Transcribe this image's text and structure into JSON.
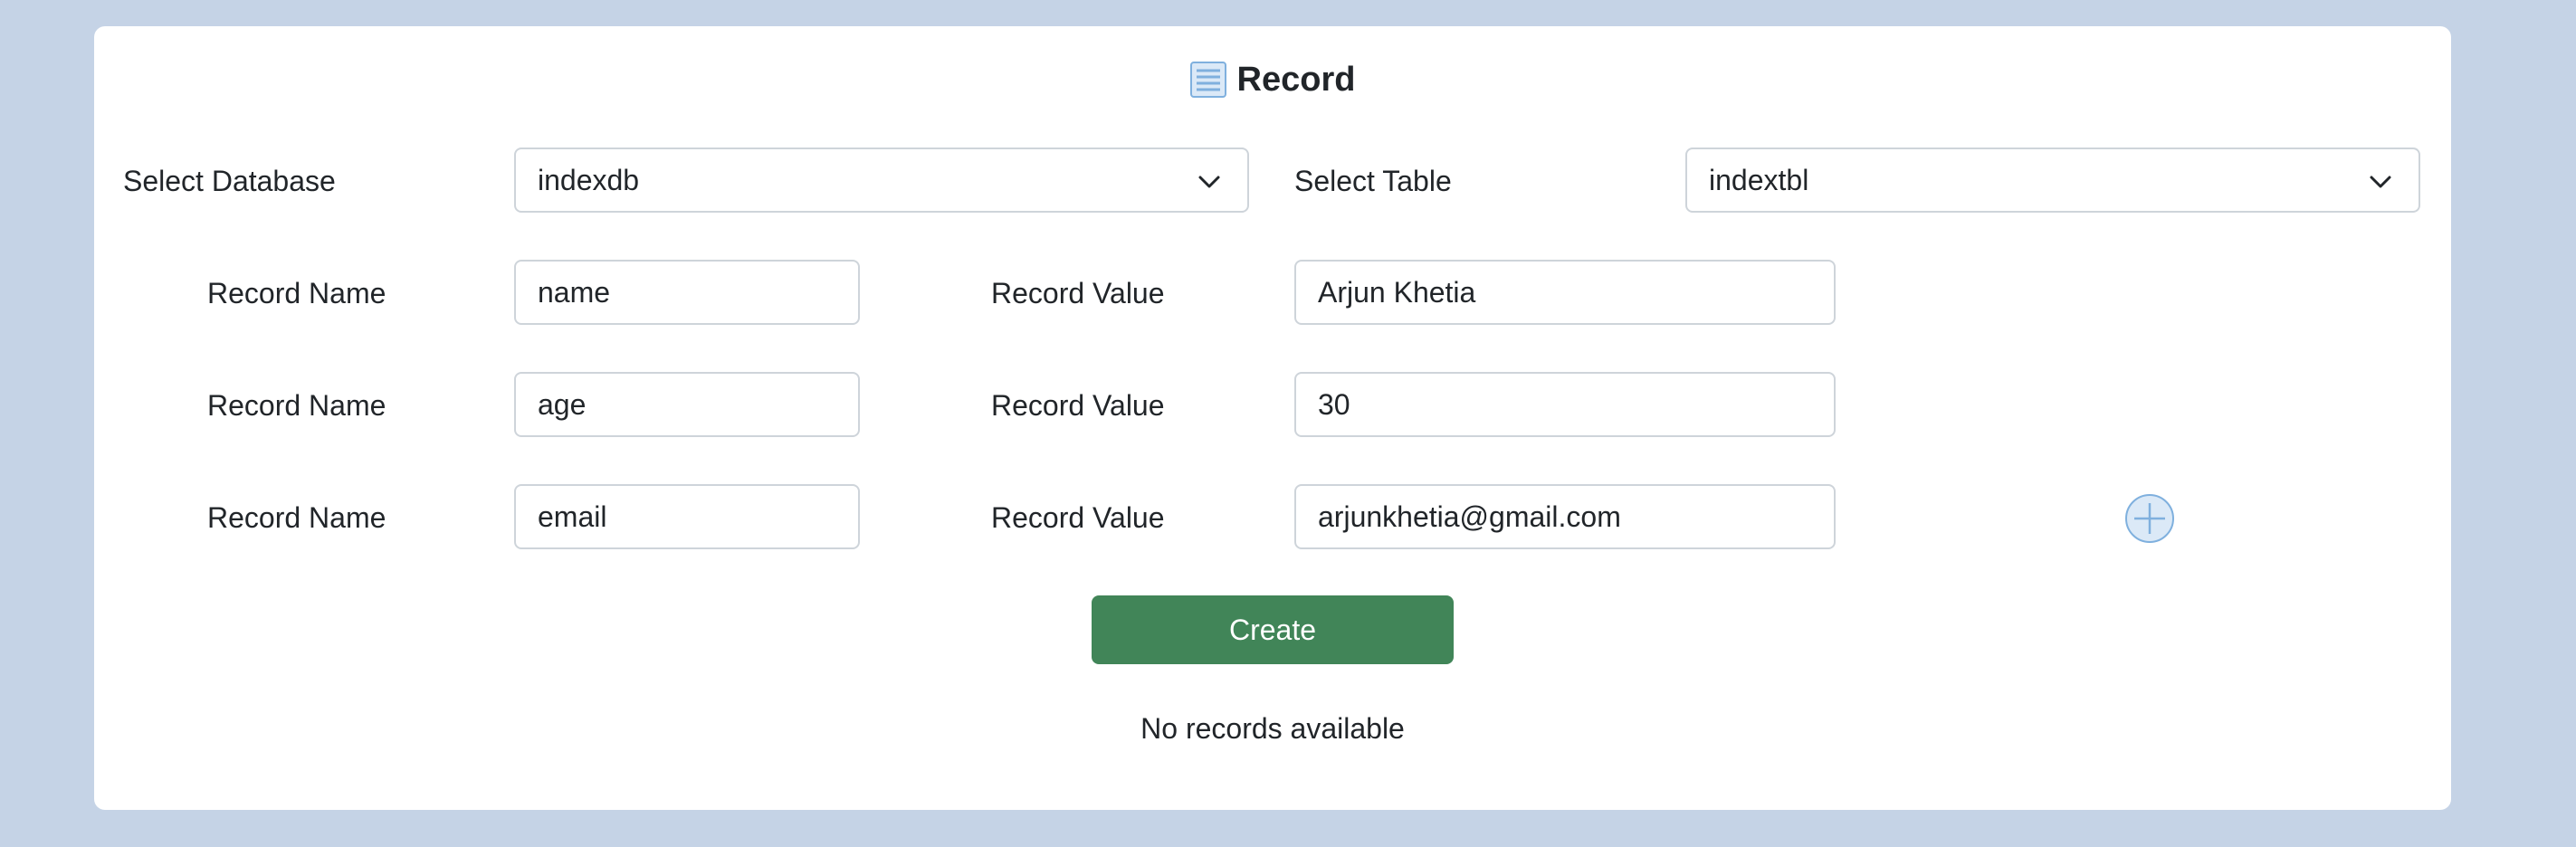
{
  "page": {
    "title": "Record",
    "title_icon": "list-document-icon",
    "accent_color": "#418558",
    "background_color": "#c5d3e6"
  },
  "database": {
    "label": "Select Database",
    "selected": "indexdb"
  },
  "table": {
    "label": "Select Table",
    "selected": "indextbl"
  },
  "records": [
    {
      "name_label": "Record Name",
      "name": "name",
      "value_label": "Record Value",
      "value": "Arjun Khetia"
    },
    {
      "name_label": "Record Name",
      "name": "age",
      "value_label": "Record Value",
      "value": "30"
    },
    {
      "name_label": "Record Name",
      "name": "email",
      "value_label": "Record Value",
      "value": "arjunkhetia@gmail.com"
    }
  ],
  "add_icon": "plus-circle-icon",
  "create_button": {
    "label": "Create"
  },
  "status": {
    "message": "No records available"
  }
}
